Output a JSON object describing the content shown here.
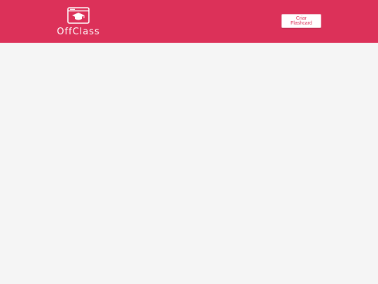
{
  "header": {
    "brand": "OffClass",
    "logo_icon": "graduation-cap-window-icon",
    "create_button_label": "Criar Flashcard",
    "background_color": "#dc3159"
  },
  "main": {
    "background_color": "#f5f5f5"
  }
}
